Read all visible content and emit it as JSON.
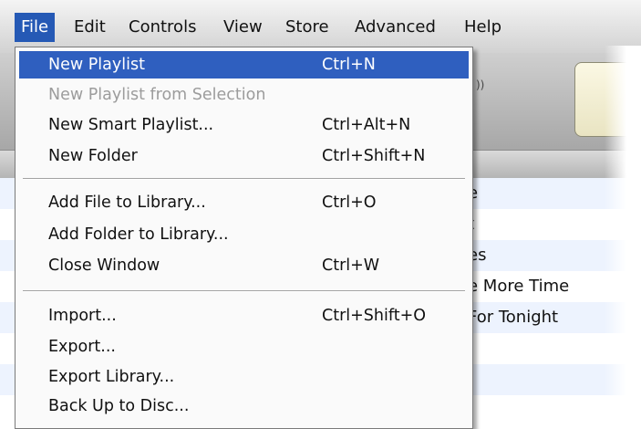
{
  "menubar": {
    "items": [
      {
        "label": "File"
      },
      {
        "label": "Edit"
      },
      {
        "label": "Controls"
      },
      {
        "label": "View"
      },
      {
        "label": "Store"
      },
      {
        "label": "Advanced"
      },
      {
        "label": "Help"
      }
    ]
  },
  "file_menu": {
    "items": [
      {
        "label": "New Playlist",
        "shortcut": "Ctrl+N"
      },
      {
        "label": "New Playlist from Selection",
        "shortcut": ""
      },
      {
        "label": "New Smart Playlist...",
        "shortcut": "Ctrl+Alt+N"
      },
      {
        "label": "New Folder",
        "shortcut": "Ctrl+Shift+N"
      },
      {
        "label": "Add File to Library...",
        "shortcut": "Ctrl+O"
      },
      {
        "label": "Add Folder to Library...",
        "shortcut": ""
      },
      {
        "label": "Close Window",
        "shortcut": "Ctrl+W"
      },
      {
        "label": "Import...",
        "shortcut": "Ctrl+Shift+O"
      },
      {
        "label": "Export...",
        "shortcut": ""
      },
      {
        "label": "Export Library...",
        "shortcut": ""
      },
      {
        "label": "Back Up to Disc...",
        "shortcut": ""
      }
    ]
  },
  "background_list": {
    "rows": [
      {
        "text": "e"
      },
      {
        "text": "t"
      },
      {
        "text": "es"
      },
      {
        "text": "e More Time"
      },
      {
        "text": "For Tonight"
      }
    ]
  },
  "colors": {
    "highlight": "#2f5fbf",
    "menubar_active": "#2559b5",
    "disabled_text": "#9c9c9c"
  }
}
